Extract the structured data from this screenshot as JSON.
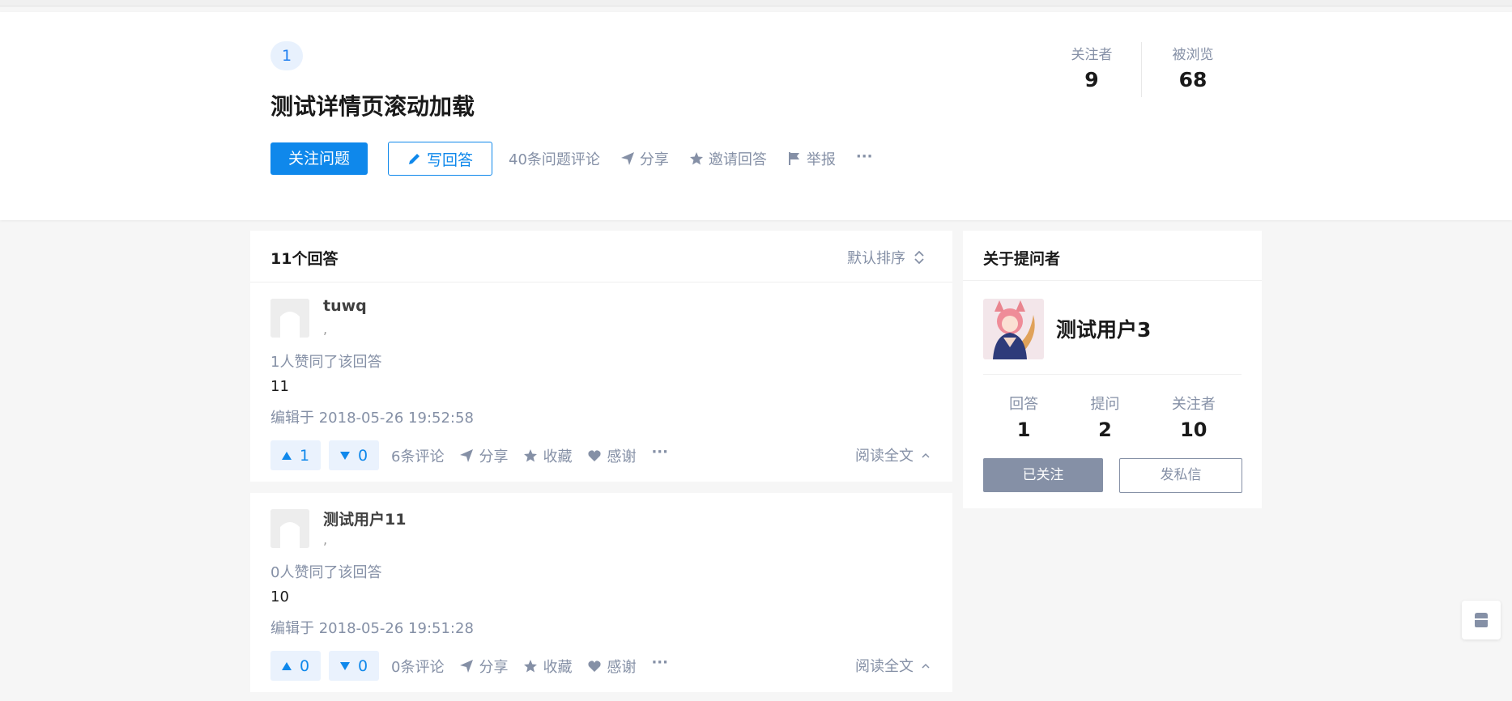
{
  "question": {
    "badge": "1",
    "title": "测试详情页滚动加载",
    "follow_label": "关注问题",
    "write_label": "写回答",
    "actions": {
      "comments": "40条问题评论",
      "share": "分享",
      "invite": "邀请回答",
      "report": "举报",
      "more": "···"
    },
    "stats": {
      "followers_label": "关注者",
      "followers": "9",
      "views_label": "被浏览",
      "views": "68"
    }
  },
  "answers_panel": {
    "count_label": "11个回答",
    "sort_label": "默认排序",
    "answers": [
      {
        "author": "tuwq",
        "subtitle": ",",
        "votes_text": "1人赞同了该回答",
        "content": "11",
        "edited": "编辑于 2018-05-26 19:52:58",
        "up": "1",
        "down": "0",
        "comments": "6条评论",
        "share": "分享",
        "collect": "收藏",
        "thanks": "感谢",
        "more": "···",
        "read_all": "阅读全文"
      },
      {
        "author": "测试用户11",
        "subtitle": ",",
        "votes_text": "0人赞同了该回答",
        "content": "10",
        "edited": "编辑于 2018-05-26 19:51:28",
        "up": "0",
        "down": "0",
        "comments": "0条评论",
        "share": "分享",
        "collect": "收藏",
        "thanks": "感谢",
        "more": "···",
        "read_all": "阅读全文"
      }
    ]
  },
  "asker": {
    "heading": "关于提问者",
    "name": "测试用户3",
    "stats": [
      {
        "label": "回答",
        "value": "1"
      },
      {
        "label": "提问",
        "value": "2"
      },
      {
        "label": "关注者",
        "value": "10"
      }
    ],
    "followed_label": "已关注",
    "message_label": "发私信"
  },
  "colors": {
    "primary": "#0f88eb",
    "muted": "#8590a6",
    "page_bg": "#f6f6f6"
  }
}
